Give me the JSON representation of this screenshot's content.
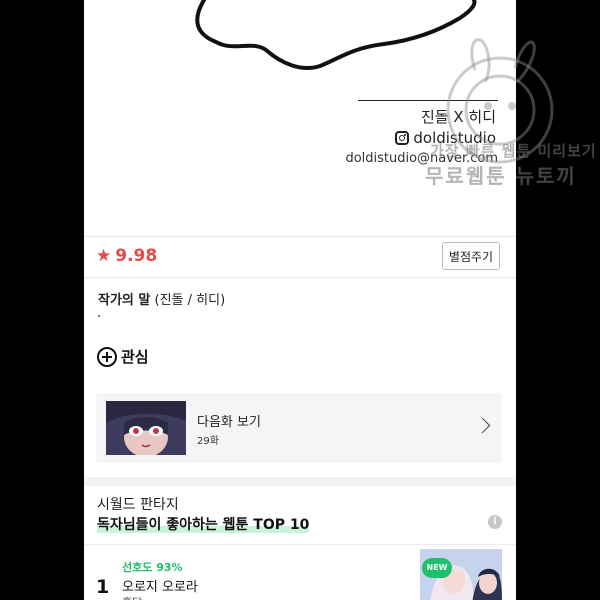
{
  "credits": {
    "authors": "진돌 X 히디",
    "instagram": "doldistudio",
    "email": "doldistudio@naver.com"
  },
  "rating": {
    "star": "★",
    "score": "9.98",
    "rate_button": "별점주기"
  },
  "author_note": {
    "label": "작가의 말",
    "names": "(진돌 / 히디)"
  },
  "favorite": {
    "label": "관심"
  },
  "next_episode": {
    "label": "다음화 보기",
    "episode": "29화"
  },
  "recommend": {
    "genre": "시월드 판타지",
    "title": "독자님들이 좋아하는 웹툰 TOP 10",
    "info_icon": "i"
  },
  "ranking": [
    {
      "rank": "1",
      "preference": "선호도 93%",
      "title": "오로지 오로라",
      "author": "홍당",
      "badge": "NEW"
    }
  ],
  "watermark": {
    "line1": "가장 빠른 웹툰 미리보기",
    "line2": "무료웹툰 뉴토끼"
  },
  "colors": {
    "rating_red": "#ea4848",
    "accent_green": "#1ec26b",
    "highlight_green": "#c8f4dc"
  }
}
